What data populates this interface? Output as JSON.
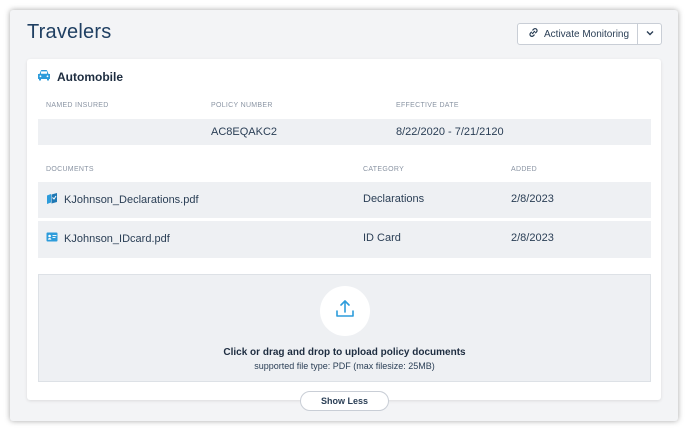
{
  "header": {
    "title": "Travelers",
    "activate_label": "Activate Monitoring"
  },
  "policy": {
    "type_label": "Automobile",
    "columns": {
      "named_insured": "NAMED INSURED",
      "policy_number": "POLICY NUMBER",
      "effective_date": "EFFECTIVE DATE"
    },
    "named_insured": "",
    "policy_number": "AC8EQAKC2",
    "effective_date": "8/22/2020 - 7/21/2120"
  },
  "documents": {
    "columns": {
      "documents": "DOCUMENTS",
      "category": "CATEGORY",
      "added": "ADDED"
    },
    "rows": [
      {
        "name": "KJohnson_Declarations.pdf",
        "category": "Declarations",
        "added": "2/8/2023",
        "icon": "declarations-icon"
      },
      {
        "name": "KJohnson_IDcard.pdf",
        "category": "ID Card",
        "added": "2/8/2023",
        "icon": "id-card-icon"
      }
    ]
  },
  "upload": {
    "title": "Click or drag and drop to upload policy documents",
    "subtitle": "supported file type: PDF (max filesize: 25MB)"
  },
  "footer": {
    "show_less_label": "Show Less"
  },
  "colors": {
    "accent": "#2d9cdb",
    "title": "#1f3f62",
    "row_bg": "#eef0f3"
  }
}
